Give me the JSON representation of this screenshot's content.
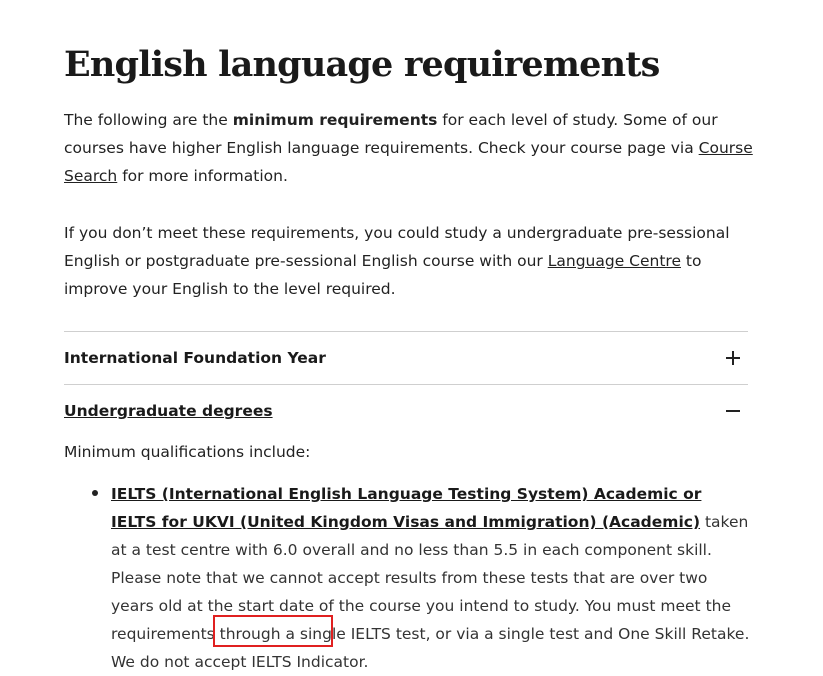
{
  "page": {
    "title": "English language requirements"
  },
  "intro": {
    "p1_part1": "The following are the ",
    "p1_bold": "minimum requirements",
    "p1_part2": " for each level of study. Some of our courses have higher English language requirements. Check your course page via ",
    "p1_link": "Course Search",
    "p1_part3": " for more information.",
    "p2_part1": "If you don’t meet these requirements, you could study a undergraduate pre-sessional English or postgraduate pre-sessional English course with our ",
    "p2_link": "Language Centre",
    "p2_part2": " to improve your English to the level required."
  },
  "accordion": [
    {
      "label": "International Foundation Year",
      "state": "collapsed",
      "icon": "plus-icon"
    },
    {
      "label": "Undergraduate degrees",
      "state": "expanded",
      "icon": "minus-icon"
    }
  ],
  "undergraduate": {
    "min_qual_label": "Minimum qualifications include:",
    "bullet_link": "IELTS (International English Language Testing System) Academic or IELTS for UKVI (United Kingdom Visas and Immigration) (Academic)",
    "bullet_text1": " taken at a test centre with 6.0 overall and no less than 5.5 in each component skill. Please note that we cannot accept results from these tests that are over two years old at the start date of the course you intend to study. You must meet the requirements through a single IELTS test, or via a single test and ",
    "bullet_highlight": "One Skill Retake",
    "bullet_text2": ". We do not accept IELTS Indicator."
  },
  "colors": {
    "highlight_box": "#e02020",
    "divider": "#cfcfcf",
    "text": "#222222"
  }
}
